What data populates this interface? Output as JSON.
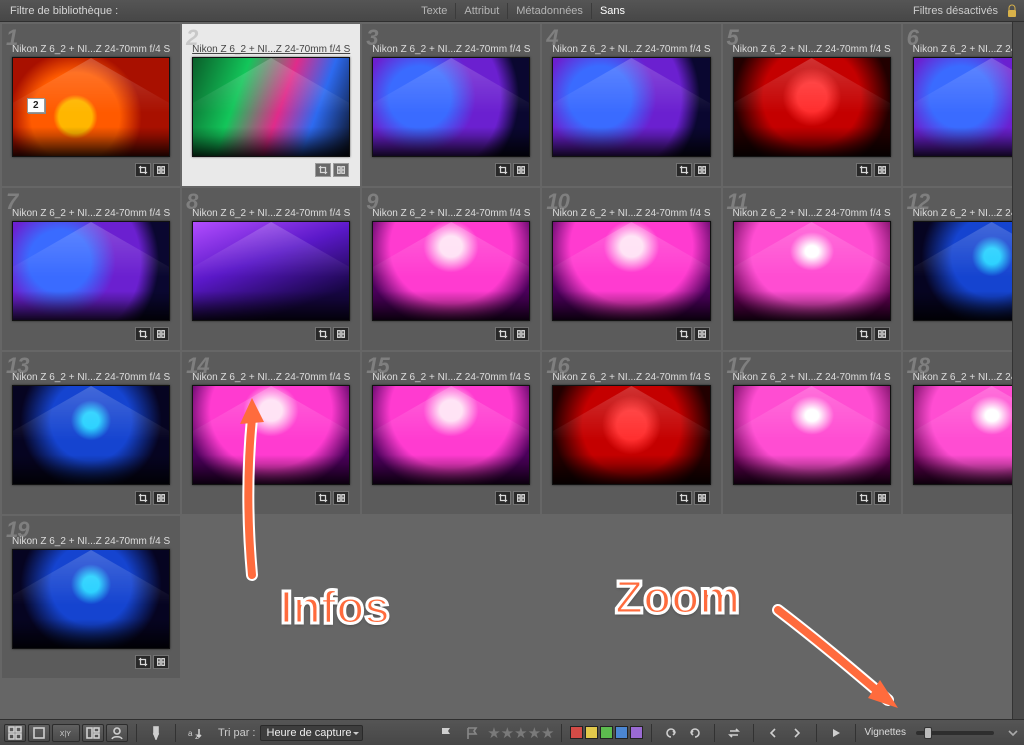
{
  "filterBar": {
    "title": "Filtre de bibliothèque :",
    "tabs": [
      "Texte",
      "Attribut",
      "Métadonnées",
      "Sans"
    ],
    "activeTab": 3,
    "right": "Filtres désactivés"
  },
  "caption": "Nikon Z 6_2 + NI...Z 24-70mm f/4 S",
  "stack": {
    "index": 0,
    "count": "2"
  },
  "selectedIndex": 1,
  "cells": [
    {
      "n": 1,
      "c": "p-red"
    },
    {
      "n": 2,
      "c": "p-green"
    },
    {
      "n": 3,
      "c": "p-blue"
    },
    {
      "n": 4,
      "c": "p-blue"
    },
    {
      "n": 5,
      "c": "p-deep"
    },
    {
      "n": 6,
      "c": "p-blue"
    },
    {
      "n": 7,
      "c": "p-blue"
    },
    {
      "n": 8,
      "c": "p-purple"
    },
    {
      "n": 9,
      "c": "p-mag"
    },
    {
      "n": 10,
      "c": "p-mag"
    },
    {
      "n": 11,
      "c": "p-pink"
    },
    {
      "n": 12,
      "c": "p-night"
    },
    {
      "n": 13,
      "c": "p-night"
    },
    {
      "n": 14,
      "c": "p-mag"
    },
    {
      "n": 15,
      "c": "p-mag"
    },
    {
      "n": 16,
      "c": "p-deep"
    },
    {
      "n": 17,
      "c": "p-pink"
    },
    {
      "n": 18,
      "c": "p-pink"
    },
    {
      "n": 19,
      "c": "p-night"
    }
  ],
  "toolbar": {
    "sortLabel": "Tri par :",
    "sortValue": "Heure de capture",
    "thumbs": "Vignettes"
  },
  "anno": {
    "infos": "Infos",
    "zoom": "Zoom"
  }
}
